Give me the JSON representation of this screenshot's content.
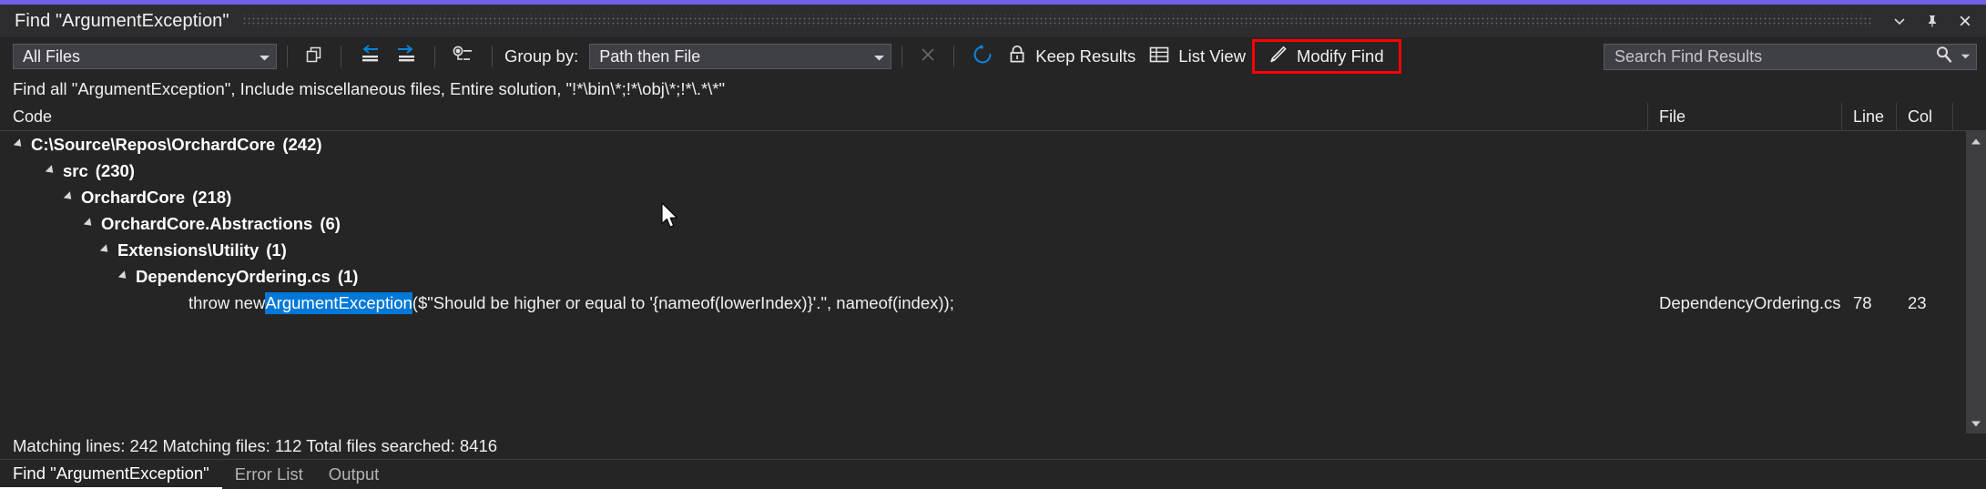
{
  "window": {
    "title": "Find \"ArgumentException\"",
    "accent_color": "#7160e8",
    "buttons": [
      {
        "name": "minimize-dropdown",
        "icon": "chevron-down-icon"
      },
      {
        "name": "pin",
        "icon": "pin-icon"
      },
      {
        "name": "close",
        "icon": "close-icon"
      }
    ]
  },
  "toolbar": {
    "file_scope": {
      "value": "All Files",
      "caret": "▼"
    },
    "copy_button": {
      "icon": "copy-icon",
      "tooltip": "Copy"
    },
    "collapse_all": {
      "icon": "collapse-all-icon"
    },
    "expand_all": {
      "icon": "expand-all-icon"
    },
    "outline_button": {
      "icon": "outline-icon"
    },
    "group_by_label": "Group by:",
    "group_by": {
      "value": "Path then File",
      "caret": "▼"
    },
    "stop_button": {
      "icon": "close-icon",
      "label": "",
      "enabled": false
    },
    "refresh_button": {
      "icon": "refresh-icon",
      "color": "#0a84d8"
    },
    "keep_results": {
      "icon": "lock-icon",
      "label": "Keep Results"
    },
    "list_view": {
      "icon": "grid-icon",
      "label": "List View"
    },
    "modify_find": {
      "icon": "pencil-icon",
      "label": "Modify Find",
      "highlight_color": "#ff0000"
    },
    "search": {
      "placeholder": "Search Find Results",
      "icon": "search-icon",
      "caret": "▼"
    }
  },
  "description": "Find all \"ArgumentException\", Include miscellaneous files, Entire solution, \"!*\\bin\\*;!*\\obj\\*;!*\\.*\\*\"",
  "columns": {
    "code": "Code",
    "file": "File",
    "line": "Line",
    "col": "Col"
  },
  "tree": [
    {
      "depth": 0,
      "label": "C:\\Source\\Repos\\OrchardCore",
      "count": "(242)",
      "expanded": true
    },
    {
      "depth": 1,
      "label": "src",
      "count": "(230)",
      "expanded": true
    },
    {
      "depth": 2,
      "label": "OrchardCore",
      "count": "(218)",
      "expanded": true
    },
    {
      "depth": 3,
      "label": "OrchardCore.Abstractions",
      "count": "(6)",
      "expanded": true
    },
    {
      "depth": 4,
      "label": "Extensions\\Utility",
      "count": "(1)",
      "expanded": true
    },
    {
      "depth": 5,
      "label": "DependencyOrdering.cs",
      "count": "(1)",
      "expanded": true
    }
  ],
  "result_row": {
    "depth": 6,
    "code_prefix": "throw new ",
    "code_match": "ArgumentException",
    "code_suffix": "($\"Should be higher or equal to '{nameof(lowerIndex)}'.\", nameof(index));",
    "file": "DependencyOrdering.cs",
    "line": "78",
    "col": "23",
    "match_highlight_color": "#0078d7"
  },
  "status": "Matching lines: 242 Matching files: 112 Total files searched: 8416",
  "tabs": [
    {
      "label": "Find \"ArgumentException\"",
      "active": true
    },
    {
      "label": "Error List",
      "active": false
    },
    {
      "label": "Output",
      "active": false
    }
  ],
  "scrollbar": {
    "up_arrow": "▲",
    "down_arrow": "▼"
  }
}
